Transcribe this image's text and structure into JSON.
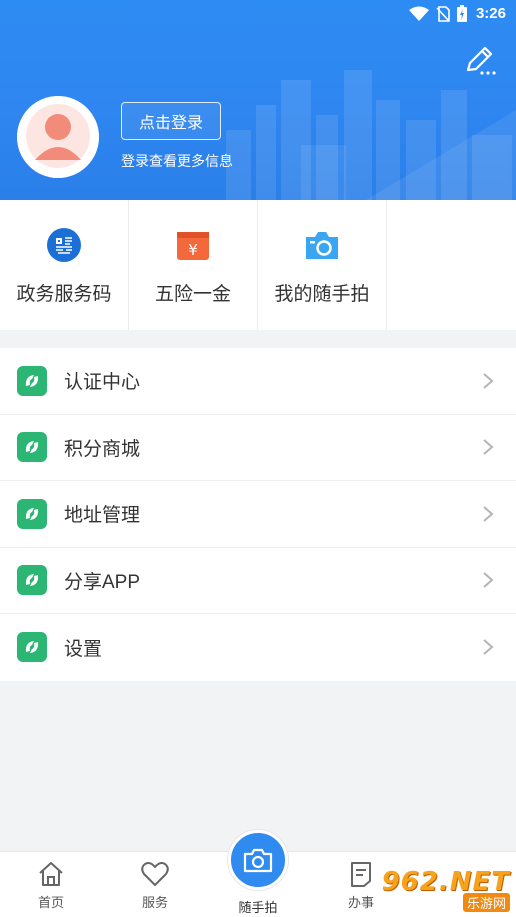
{
  "status_bar": {
    "time": "3:26"
  },
  "profile": {
    "login_button": "点击登录",
    "login_hint": "登录查看更多信息"
  },
  "quick_actions": [
    {
      "label": "政务服务码",
      "icon": "qr-code-icon",
      "color": "#1d6fd8"
    },
    {
      "label": "五险一金",
      "icon": "wallet-icon",
      "color": "#f4693b"
    },
    {
      "label": "我的随手拍",
      "icon": "camera-icon",
      "color": "#3aa6f2"
    }
  ],
  "menu": [
    {
      "label": "认证中心",
      "icon": "app-icon"
    },
    {
      "label": "积分商城",
      "icon": "app-icon"
    },
    {
      "label": "地址管理",
      "icon": "app-icon"
    },
    {
      "label": "分享APP",
      "icon": "app-icon"
    },
    {
      "label": "设置",
      "icon": "app-icon"
    }
  ],
  "bottom_nav": {
    "home": "首页",
    "service": "服务",
    "snapshot": "随手拍",
    "affairs": "办事"
  },
  "watermark": {
    "main": "962.NET",
    "sub": "乐游网"
  },
  "colors": {
    "header_blue": "#2f86f0",
    "accent_green": "#2bb673",
    "text_dark": "#333333"
  }
}
